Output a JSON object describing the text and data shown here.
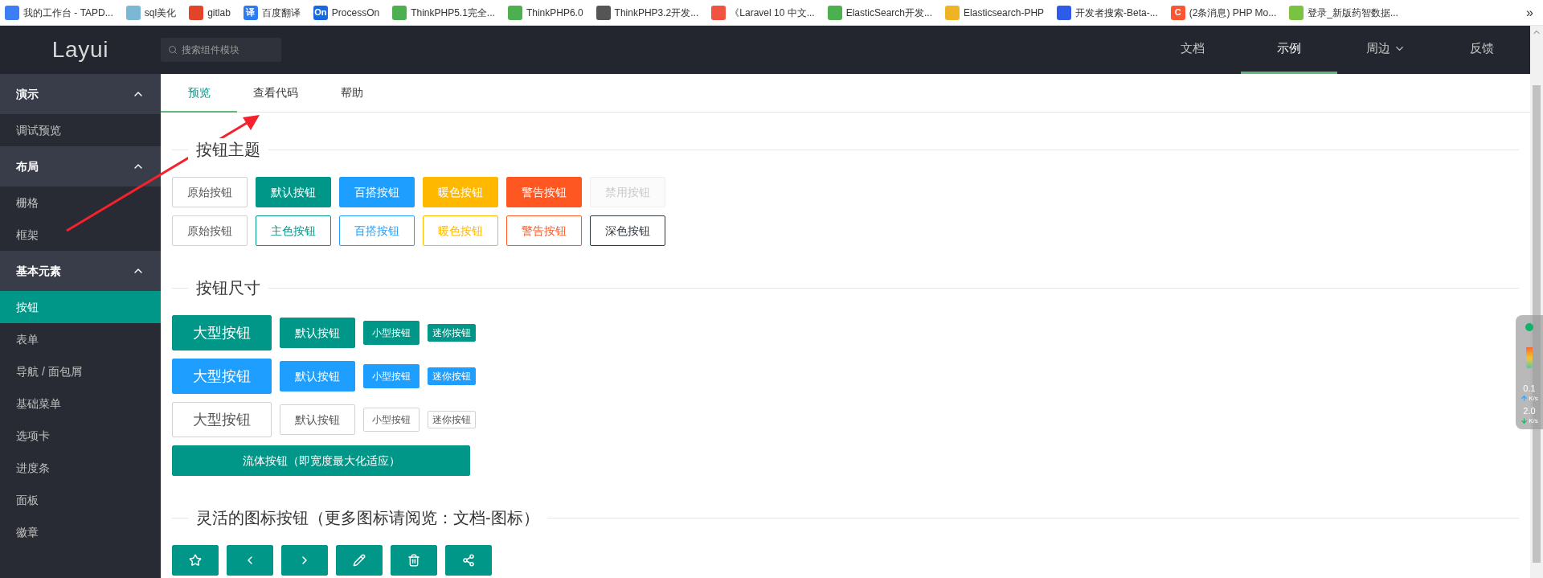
{
  "bookmarks": [
    {
      "label": "我的工作台 - TAPD...",
      "color": "#3d7ef5"
    },
    {
      "label": "sql美化",
      "color": "#7ab8d6"
    },
    {
      "label": "gitlab",
      "color": "#e24329"
    },
    {
      "label": "百度翻译",
      "color": "#2a7cf0",
      "glyph": "译"
    },
    {
      "label": "ProcessOn",
      "color": "#1769e0",
      "glyph": "On"
    },
    {
      "label": "ThinkPHP5.1完全...",
      "color": "#4caf50"
    },
    {
      "label": "ThinkPHP6.0",
      "color": "#4caf50"
    },
    {
      "label": "ThinkPHP3.2开发...",
      "color": "#555555"
    },
    {
      "label": "《Laravel 10 中文...",
      "color": "#f05340"
    },
    {
      "label": "ElasticSearch开发...",
      "color": "#4caf50"
    },
    {
      "label": "Elasticsearch-PHP",
      "color": "#f0b323"
    },
    {
      "label": "开发者搜索-Beta-...",
      "color": "#2f5bea"
    },
    {
      "label": "(2条消息) PHP Mo...",
      "color": "#fc5531",
      "glyph": "C"
    },
    {
      "label": "登录_新版药智数据...",
      "color": "#7cc242"
    }
  ],
  "more_bookmarks": "»",
  "header": {
    "logo": "Layui",
    "search": {
      "placeholder": "搜索组件模块"
    },
    "nav": [
      {
        "label": "文档",
        "selected": false,
        "has_menu": false
      },
      {
        "label": "示例",
        "selected": true,
        "has_menu": false
      },
      {
        "label": "周边",
        "selected": false,
        "has_menu": true
      },
      {
        "label": "反馈",
        "selected": false,
        "has_menu": false
      }
    ]
  },
  "sidebar": {
    "groups": [
      {
        "label": "演示",
        "expanded": true,
        "children": [
          {
            "label": "调试预览",
            "selected": false
          }
        ]
      },
      {
        "label": "布局",
        "expanded": true,
        "children": [
          {
            "label": "栅格",
            "selected": false
          },
          {
            "label": "框架",
            "selected": false
          }
        ]
      },
      {
        "label": "基本元素",
        "expanded": true,
        "children": [
          {
            "label": "按钮",
            "selected": true
          },
          {
            "label": "表单",
            "selected": false
          },
          {
            "label": "导航 / 面包屑",
            "selected": false
          },
          {
            "label": "基础菜单",
            "selected": false
          },
          {
            "label": "选项卡",
            "selected": false
          },
          {
            "label": "进度条",
            "selected": false
          },
          {
            "label": "面板",
            "selected": false
          },
          {
            "label": "徽章",
            "selected": false
          }
        ]
      }
    ]
  },
  "tabs": [
    {
      "label": "预览",
      "selected": true
    },
    {
      "label": "查看代码",
      "selected": false
    },
    {
      "label": "帮助",
      "selected": false
    }
  ],
  "sections": [
    {
      "title": "按钮主题",
      "rows": [
        {
          "kind": "plain",
          "buttons": [
            {
              "label": "原始按钮",
              "kind": "primary-plain"
            },
            {
              "label": "默认按钮",
              "kind": "green"
            },
            {
              "label": "百搭按钮",
              "kind": "blue"
            },
            {
              "label": "暖色按钮",
              "kind": "orange"
            },
            {
              "label": "警告按钮",
              "kind": "red"
            },
            {
              "label": "禁用按钮",
              "kind": "disabled"
            }
          ]
        },
        {
          "kind": "plain",
          "buttons": [
            {
              "label": "原始按钮",
              "kind": "primary-plain"
            },
            {
              "label": "主色按钮",
              "kind": "green-outline"
            },
            {
              "label": "百搭按钮",
              "kind": "blue-outline"
            },
            {
              "label": "暖色按钮",
              "kind": "orange-outline"
            },
            {
              "label": "警告按钮",
              "kind": "red-outline"
            },
            {
              "label": "深色按钮",
              "kind": "dark-outline"
            }
          ]
        }
      ]
    },
    {
      "title": "按钮尺寸",
      "rows": [
        {
          "kind": "sizes",
          "buttons": [
            {
              "label": "大型按钮",
              "kind": "green"
            },
            {
              "label": "默认按钮",
              "kind": "green"
            },
            {
              "label": "小型按钮",
              "kind": "green"
            },
            {
              "label": "迷你按钮",
              "kind": "green"
            }
          ]
        },
        {
          "kind": "sizes",
          "buttons": [
            {
              "label": "大型按钮",
              "kind": "blue"
            },
            {
              "label": "默认按钮",
              "kind": "blue"
            },
            {
              "label": "小型按钮",
              "kind": "blue"
            },
            {
              "label": "迷你按钮",
              "kind": "blue"
            }
          ]
        },
        {
          "kind": "sizes",
          "buttons": [
            {
              "label": "大型按钮",
              "kind": "primary-plain"
            },
            {
              "label": "默认按钮",
              "kind": "primary-plain"
            },
            {
              "label": "小型按钮",
              "kind": "primary-plain"
            },
            {
              "label": "迷你按钮",
              "kind": "primary-plain"
            }
          ]
        },
        {
          "kind": "fluid",
          "buttons": [
            {
              "label": "流体按钮（即宽度最大化适应）",
              "kind": "green"
            }
          ]
        }
      ]
    },
    {
      "title": "灵活的图标按钮（更多图标请阅览：文档-图标）",
      "rows": [
        {
          "kind": "icons",
          "buttons": [
            {
              "kind": "green"
            },
            {
              "kind": "green"
            },
            {
              "kind": "green"
            },
            {
              "kind": "green"
            },
            {
              "kind": "green"
            },
            {
              "kind": "green"
            }
          ]
        }
      ]
    }
  ],
  "net_monitor": {
    "upload": "0.1",
    "upload_unit": "K/s",
    "download": "2.0",
    "download_unit": "K/s"
  }
}
